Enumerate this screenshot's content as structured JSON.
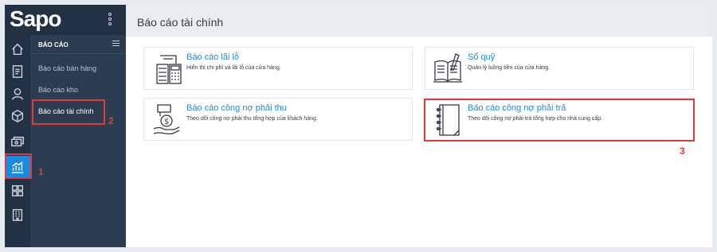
{
  "app": {
    "logo": "Sapo"
  },
  "sidebar": {
    "icons": [
      {
        "name": "home-icon"
      },
      {
        "name": "orders-icon"
      },
      {
        "name": "customer-icon"
      },
      {
        "name": "product-box-icon"
      },
      {
        "name": "cash-icon"
      },
      {
        "name": "report-chart-icon",
        "active": true
      },
      {
        "name": "apps-grid-icon"
      },
      {
        "name": "store-building-icon"
      }
    ],
    "active_color": "#1a8be0"
  },
  "submenu": {
    "title": "BÁO CÁO",
    "items": [
      {
        "label": "Báo cáo bán hàng"
      },
      {
        "label": "Báo cáo kho"
      },
      {
        "label": "Báo cáo tài chính",
        "active": true
      }
    ]
  },
  "page": {
    "title": "Báo cáo tài chính",
    "cards": [
      {
        "title": "Báo cáo lãi lỗ",
        "desc": "Hiển thị chi phí và lãi lỗ của cửa hàng.",
        "icon": "calculator-receipt-icon"
      },
      {
        "title": "Sổ quỹ",
        "desc": "Quản lý luồng tiền của cửa hàng.",
        "icon": "cashbook-icon"
      },
      {
        "title": "Báo cáo công nợ phải thu",
        "desc": "Theo dõi công nợ phải thu tổng hợp của khách hàng.",
        "icon": "money-hand-icon"
      },
      {
        "title": "Báo cáo công nợ phải trả",
        "desc": "Theo dõi công nợ phải trả tổng hợp cho nhà cung cấp.",
        "icon": "notebook-icon"
      }
    ]
  },
  "annotations": {
    "steps": [
      "1",
      "2",
      "3"
    ],
    "color": "#e53935"
  }
}
